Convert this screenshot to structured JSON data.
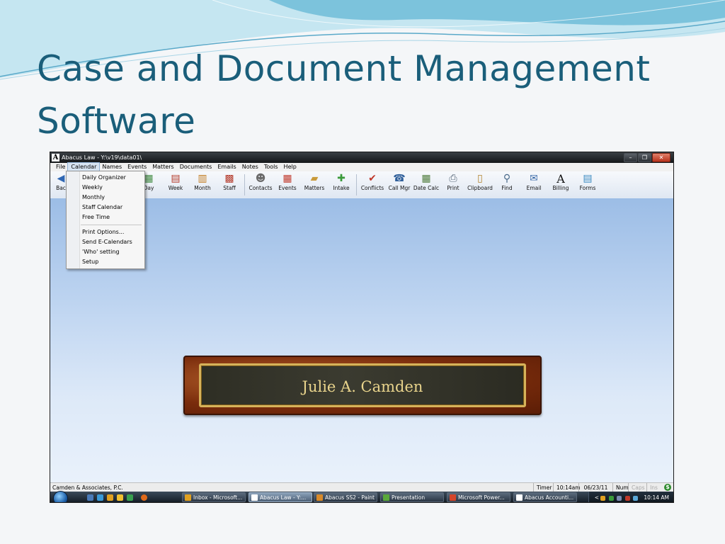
{
  "slide": {
    "title_line1": "Case and Document Management",
    "title_line2": "Software"
  },
  "window": {
    "title": "Abacus Law  -  Y:\\v19\\data01\\",
    "app_icon_letter": "A"
  },
  "menubar": {
    "items": [
      "File",
      "Calendar",
      "Names",
      "Events",
      "Matters",
      "Documents",
      "Emails",
      "Notes",
      "Tools",
      "Help"
    ],
    "active": "Calendar"
  },
  "toolbar": {
    "back_label": "Bac",
    "day_label": "Day",
    "week_label": "Week",
    "month_label": "Month",
    "staff_label": "Staff",
    "contacts_label": "Contacts",
    "events_label": "Events",
    "matters_label": "Matters",
    "intake_label": "Intake",
    "conflicts_label": "Conflicts",
    "callmgr_label": "Call Mgr",
    "datecalc_label": "Date Calc",
    "print_label": "Print",
    "clipboard_label": "Clipboard",
    "find_label": "Find",
    "email_label": "Email",
    "billing_label": "Billing",
    "forms_label": "Forms"
  },
  "calendar_menu": {
    "items": [
      "Daily Organizer",
      "Weekly",
      "Monthly",
      "Staff Calendar",
      "Free Time",
      "Print Options...",
      "Send E-Calendars",
      "'Who' setting",
      "Setup"
    ]
  },
  "nameplate": {
    "name": "Julie A. Camden"
  },
  "statusbar": {
    "firm": "Camden & Associates, P.C.",
    "timer": "Timer",
    "time": "10:14am",
    "date": "06/23/11",
    "num": "Num",
    "caps": "Caps",
    "ins": "Ins",
    "dollar": "$"
  },
  "taskbar": {
    "tasks": [
      "Inbox - Microsoft...",
      "Abacus Law  -  Y:...",
      "Abacus SS2 - Paint",
      "Presentation",
      "Microsoft Power...",
      "Abacus Accounti..."
    ],
    "active_task": "Abacus Law  -  Y:...",
    "tray_arrow": "<",
    "clock": "10:14 AM"
  },
  "colors": {
    "title": "#1a5e7a",
    "workspace_top": "#9cbde6",
    "nameplate_text": "#e9d48c",
    "wood": "#7a2c0c"
  }
}
